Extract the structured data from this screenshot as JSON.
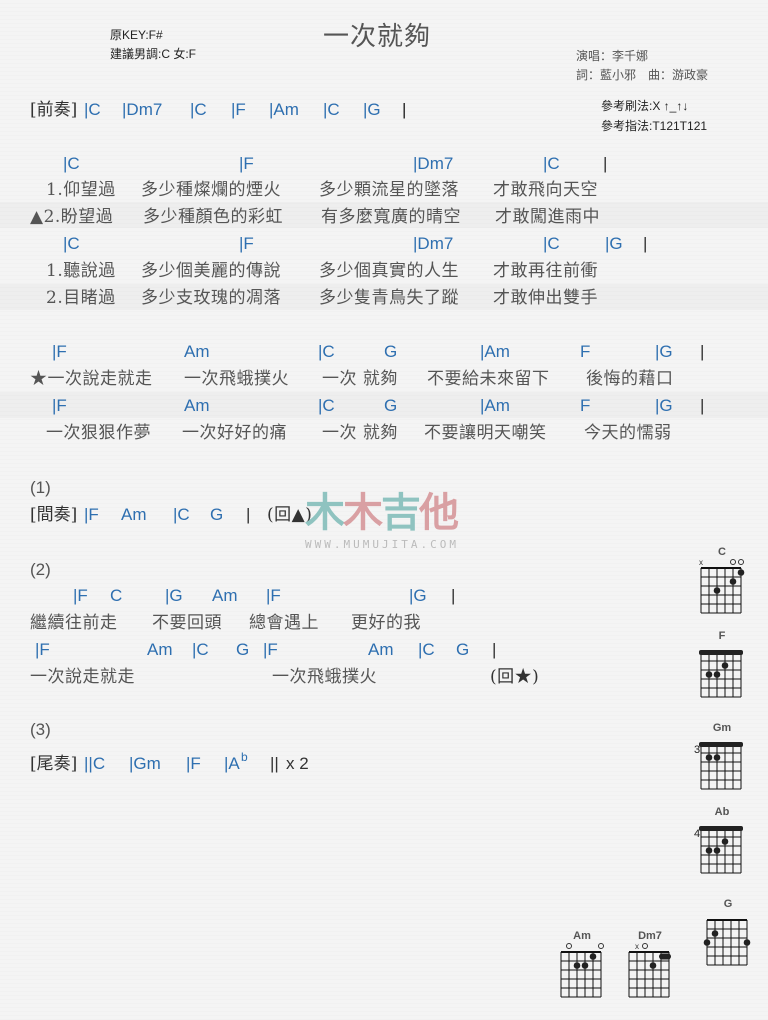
{
  "header": {
    "original_key": "原KEY:F#",
    "suggested_key": "建議男調:C 女:F",
    "title": "一次就夠",
    "singer": "演唱：李千娜",
    "writers": "詞：藍小邪　曲：游政豪",
    "strum": "參考刷法:X ↑_↑↓",
    "pick": "參考指法:T121T121"
  },
  "intro": {
    "label": "[前奏]",
    "chords": [
      "|C",
      "|Dm7",
      "|C",
      "|F",
      "|Am",
      "|C",
      "|G",
      "|"
    ]
  },
  "verse1": {
    "chords": [
      "|C",
      "|F",
      "|Dm7",
      "|C",
      "|"
    ],
    "lyrics1": [
      "1.仰望過",
      "多少種燦爛的煙火",
      "多少顆流星的墜落",
      "才敢飛向天空"
    ],
    "lyrics2": [
      "▲2.盼望過",
      "多少種顏色的彩虹",
      "有多麼寬廣的晴空",
      "才敢闖進雨中"
    ]
  },
  "verse2": {
    "chords": [
      "|C",
      "|F",
      "|Dm7",
      "|C",
      "|G",
      "|"
    ],
    "lyrics1": [
      "1.聽說過",
      "多少個美麗的傳說",
      "多少個真實的人生",
      "才敢再往前衝"
    ],
    "lyrics2": [
      "2.目睹過",
      "多少支玫瑰的凋落",
      "多少隻青鳥失了蹤",
      "才敢伸出雙手"
    ]
  },
  "chorus": {
    "chords1": [
      "|F",
      "Am",
      "|C",
      "G",
      "|Am",
      "F",
      "|G",
      "|"
    ],
    "lyrics1": [
      "★一次說走就走",
      "一次飛蛾撲火",
      "一次 就夠",
      "不要給未來留下",
      "後悔的藉口"
    ],
    "chords2": [
      "|F",
      "Am",
      "|C",
      "G",
      "|Am",
      "F",
      "|G",
      "|"
    ],
    "lyrics2": [
      "一次狠狠作夢",
      "一次好好的痛",
      "一次 就夠",
      "不要讓明天嘲笑",
      "今天的懦弱"
    ]
  },
  "part1": {
    "number": "(1)",
    "label": "[間奏]",
    "chords": [
      "|F",
      "Am",
      "|C",
      "G",
      "|"
    ],
    "repeat": "(回▲)"
  },
  "part2": {
    "number": "(2)",
    "chords1": [
      "|F",
      "C",
      "|G",
      "Am",
      "|F",
      "|G",
      "|"
    ],
    "lyrics1": [
      "繼續往前走",
      "不要回頭",
      "總會遇上",
      "更好的我"
    ],
    "chords2": [
      "|F",
      "Am",
      "|C",
      "G",
      "|F",
      "Am",
      "|C",
      "G",
      "|"
    ],
    "lyrics2": [
      "一次說走就走",
      "一次飛蛾撲火",
      "(回★)"
    ]
  },
  "part3": {
    "number": "(3)",
    "label": "[尾奏]",
    "chords": [
      "||C",
      "|Gm",
      "|F",
      "|A",
      "b",
      "||",
      "x 2"
    ]
  },
  "watermark": {
    "chinese": "木木吉他",
    "url": "WWW.MUMUJITA.COM"
  },
  "chord_diagrams": [
    {
      "name": "C",
      "fret": "",
      "markers": "x  oo"
    },
    {
      "name": "F",
      "fret": "",
      "markers": ""
    },
    {
      "name": "Gm",
      "fret": "3",
      "markers": ""
    },
    {
      "name": "Ab",
      "fret": "4",
      "markers": ""
    },
    {
      "name": "G",
      "fret": "",
      "markers": ""
    },
    {
      "name": "Am",
      "fret": "",
      "markers": "o   o"
    },
    {
      "name": "Dm7",
      "fret": "",
      "markers": "x o"
    }
  ],
  "colors": {
    "chord": "#2e6fb0",
    "lyric": "#555555",
    "watermark_teal": "#8fc3c0",
    "watermark_pink": "#d9a0a3"
  }
}
